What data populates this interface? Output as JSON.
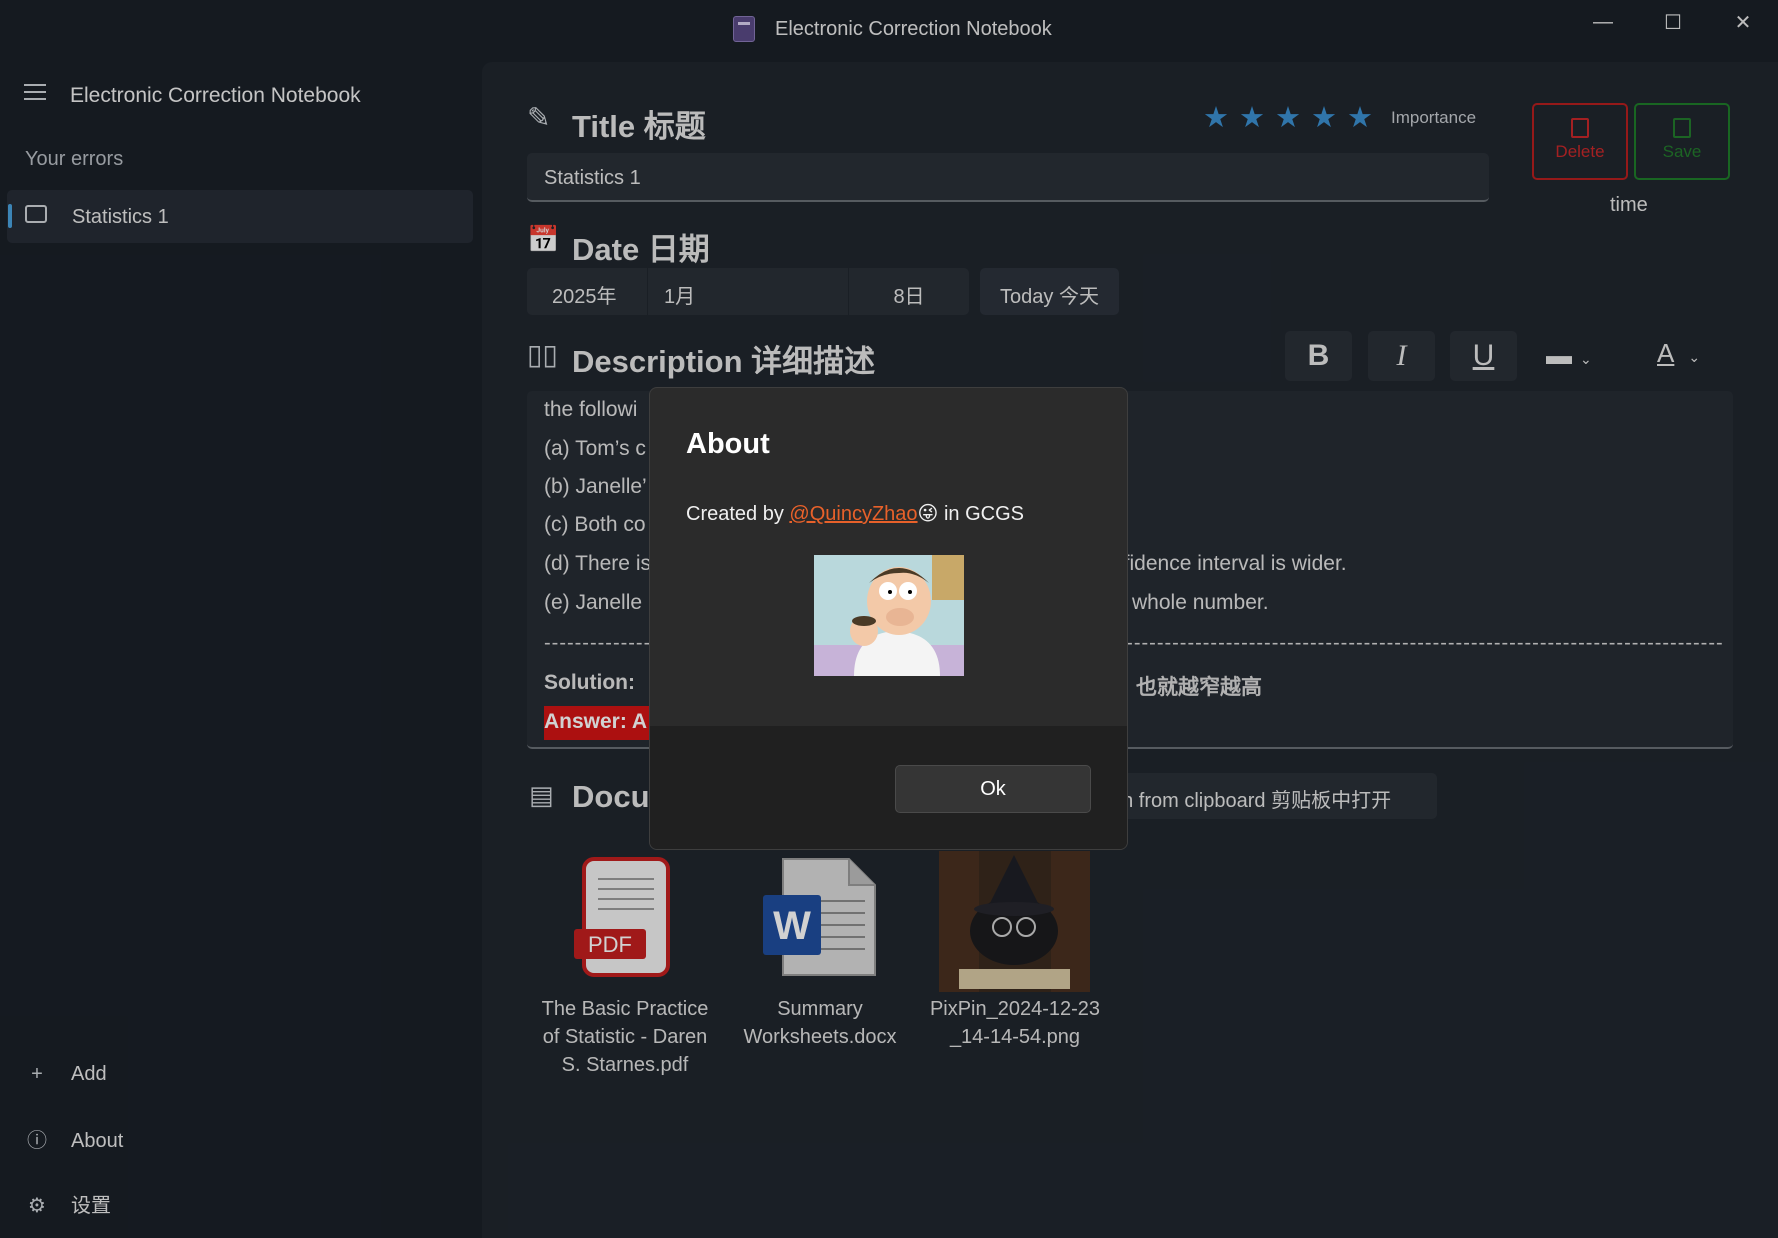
{
  "window": {
    "title": "Electronic Correction Notebook",
    "minimize": "—",
    "maximize": "☐",
    "close": "✕"
  },
  "sidebar": {
    "title": "Electronic Correction Notebook",
    "section": "Your errors",
    "items": [
      {
        "label": "Statistics 1",
        "icon": "chat-icon"
      }
    ],
    "add_label": "Add",
    "about_label": "About",
    "settings_label": "设置"
  },
  "main": {
    "title_heading": "Title 标题",
    "title_value": "Statistics 1",
    "importance": {
      "label": "Importance",
      "stars": 5
    },
    "delete_label": "Delete",
    "save_label": "Save",
    "time_label": "time",
    "date_heading": "Date 日期",
    "date": {
      "year": "2025年",
      "month": "1月",
      "day": "8日"
    },
    "today_label": "Today 今天",
    "description_heading": "Description 详细描述",
    "format": {
      "bold": "B",
      "italic": "I",
      "underline": "U"
    },
    "editor_lines": [
      "the followi",
      "(a) Tom’s c",
      "(b) Janelle’",
      "(c) Both co",
      "(d) There is",
      "(e) Janelle"
    ],
    "editor_right_fragments": {
      "d": "nfidence interval is wider.",
      "e": "whole number."
    },
    "separator": "------------------------------------------------------------------------------------------------------------------------------------------------------------------------------",
    "solution_label": "Solution:",
    "solution_fragment": "也就越窄越高",
    "answer_label": "Answer:  A",
    "documents_heading": "Docu",
    "clipboard_label": "en from clipboard 剪贴板中打开",
    "files": [
      {
        "name": "The Basic Practice of Statistic - Daren S. Starnes.pdf",
        "lines": [
          "The Basic Practice",
          "of Statistic - Daren",
          "S. Starnes.pdf"
        ],
        "icon": "pdf-icon"
      },
      {
        "name": "Summary Worksheets.docx",
        "lines": [
          "Summary",
          "Worksheets.docx"
        ],
        "icon": "word-icon"
      },
      {
        "name": "PixPin_2024-12-23_14-14-54.png",
        "lines": [
          "PixPin_2024-12-23",
          "_14-14-54.png"
        ],
        "icon": "image-thumbnail"
      }
    ]
  },
  "dialog": {
    "title": "About",
    "text_before": "Created by ",
    "author": "@QuincyZhao",
    "emoji": "😜",
    "text_after": " in GCGS",
    "ok_label": "Ok"
  },
  "colors": {
    "accent": "#4aa3df",
    "star": "#3b8fd0",
    "delete": "#c8282a",
    "save": "#237a2c",
    "link": "#e8612a",
    "answer_highlight": "#d21414"
  }
}
